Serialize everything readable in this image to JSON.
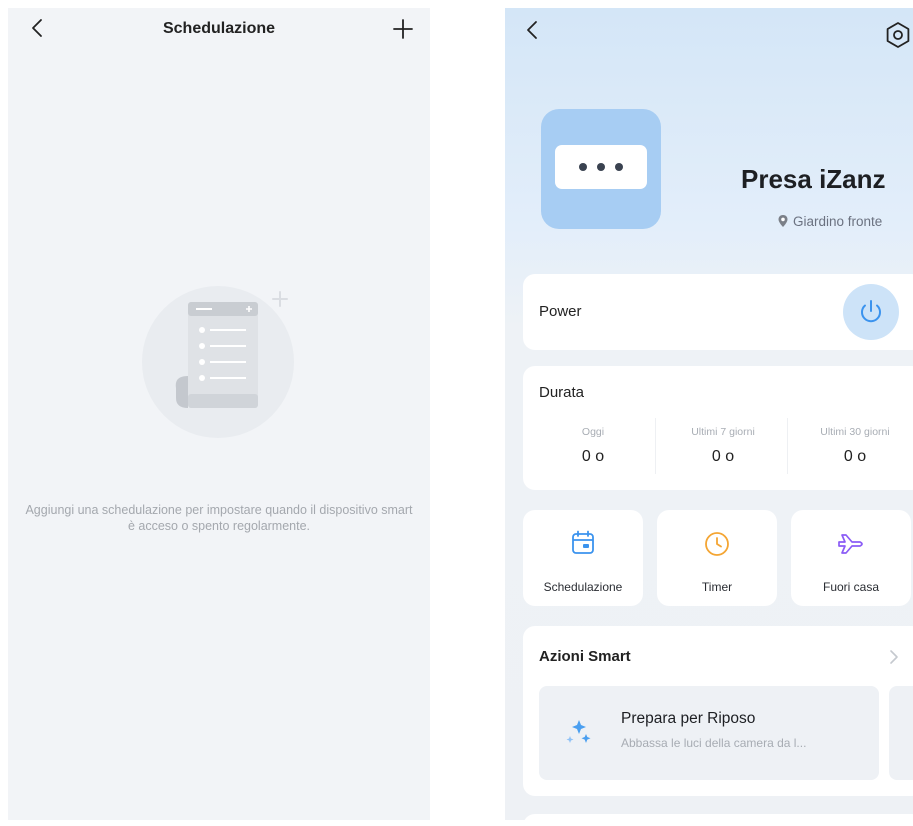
{
  "schedule_screen": {
    "title": "Schedulazione",
    "empty_message": "Aggiungi una schedulazione per impostare quando il dispositivo smart è acceso o spento regolarmente."
  },
  "device_screen": {
    "device_name": "Presa iZanz",
    "location": "Giardino fronte",
    "power": {
      "label": "Power"
    },
    "duration": {
      "label": "Durata",
      "columns": [
        {
          "caption": "Oggi",
          "value": "0 o"
        },
        {
          "caption": "Ultimi 7 giorni",
          "value": "0 o"
        },
        {
          "caption": "Ultimi 30 giorni",
          "value": "0 o"
        }
      ]
    },
    "features": [
      {
        "label": "Schedulazione",
        "icon": "calendar-icon"
      },
      {
        "label": "Timer",
        "icon": "clock-icon"
      },
      {
        "label": "Fuori casa",
        "icon": "plane-icon"
      }
    ],
    "smart_actions": {
      "header": "Azioni Smart",
      "items": [
        {
          "name": "Prepara per Riposo",
          "description": "Abbassa le luci della camera da l..."
        }
      ]
    }
  },
  "colors": {
    "accent_blue": "#3b93ee",
    "timer_orange": "#f4a533",
    "plane_purple": "#8b5cf6",
    "device_tile": "#a7cdf3"
  }
}
